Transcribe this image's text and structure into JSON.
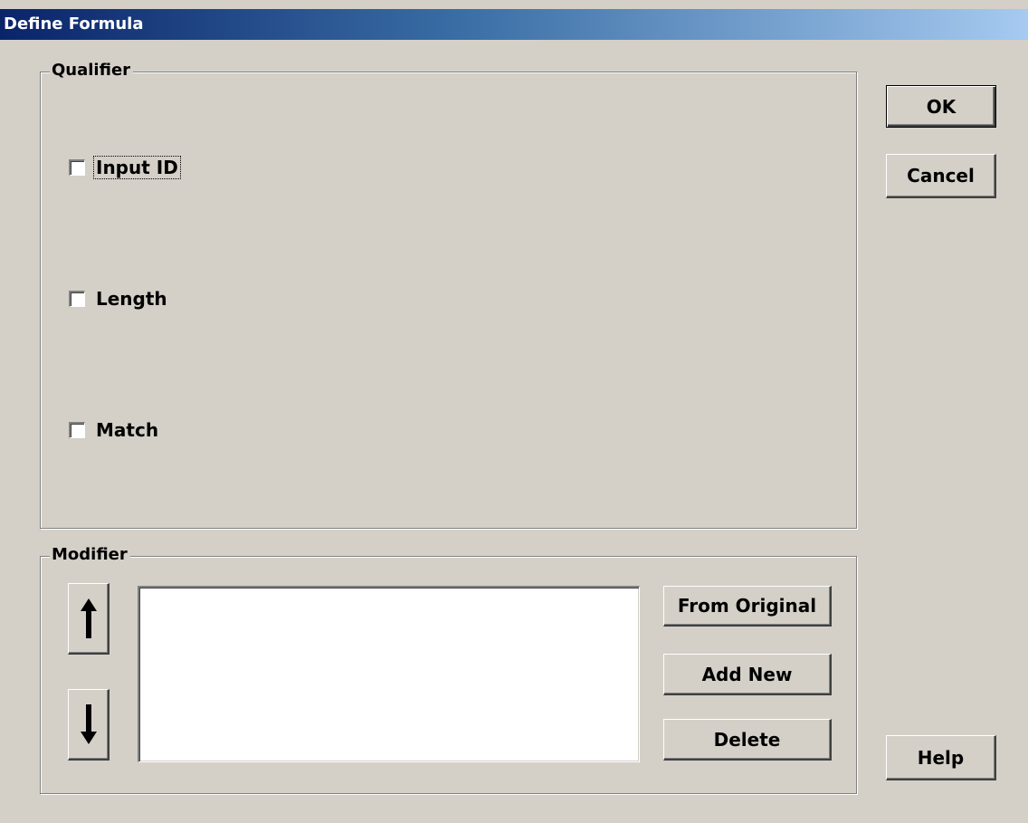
{
  "window": {
    "title": "Define Formula"
  },
  "qualifier": {
    "label": "Qualifier",
    "checkboxes": [
      {
        "label": "Input ID",
        "checked": false
      },
      {
        "label": "Length",
        "checked": false
      },
      {
        "label": "Match",
        "checked": false
      }
    ]
  },
  "modifier": {
    "label": "Modifier",
    "list_items": [],
    "buttons": {
      "from_original": "From Original",
      "add_new": "Add New",
      "delete": "Delete"
    },
    "move_up_icon": "up-arrow",
    "move_down_icon": "down-arrow"
  },
  "actions": {
    "ok": "OK",
    "cancel": "Cancel",
    "help": "Help"
  }
}
